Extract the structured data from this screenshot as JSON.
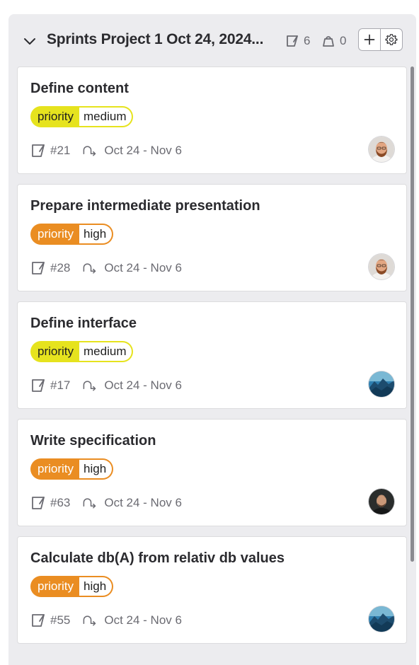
{
  "column": {
    "title": "Sprints Project 1 Oct 24, 2024...",
    "issues_count": "6",
    "weight_count": "0",
    "icons": {
      "collapse": "chevron-down-icon",
      "issues": "issues-icon",
      "weight": "weight-icon",
      "add": "plus-icon",
      "settings": "gear-icon"
    }
  },
  "cards": [
    {
      "title": "Define content",
      "label_key": "priority",
      "label_value": "medium",
      "issue_ref": "#21",
      "dates": "Oct 24 - Nov 6",
      "avatar": "bearded-man-avatar"
    },
    {
      "title": "Prepare intermediate presentation",
      "label_key": "priority",
      "label_value": "high",
      "issue_ref": "#28",
      "dates": "Oct 24 - Nov 6",
      "avatar": "bearded-man-avatar"
    },
    {
      "title": "Define interface",
      "label_key": "priority",
      "label_value": "medium",
      "issue_ref": "#17",
      "dates": "Oct 24 - Nov 6",
      "avatar": "mountain-avatar"
    },
    {
      "title": "Write specification",
      "label_key": "priority",
      "label_value": "high",
      "issue_ref": "#63",
      "dates": "Oct 24 - Nov 6",
      "avatar": "dark-portrait-avatar"
    },
    {
      "title": "Calculate db(A) from relativ db values",
      "label_key": "priority",
      "label_value": "high",
      "issue_ref": "#55",
      "dates": "Oct 24 - Nov 6",
      "avatar": "mountain-avatar"
    }
  ],
  "colors": {
    "priority_medium": "#e6e31e",
    "priority_high": "#ea8d22",
    "column_bg": "#ececef"
  }
}
